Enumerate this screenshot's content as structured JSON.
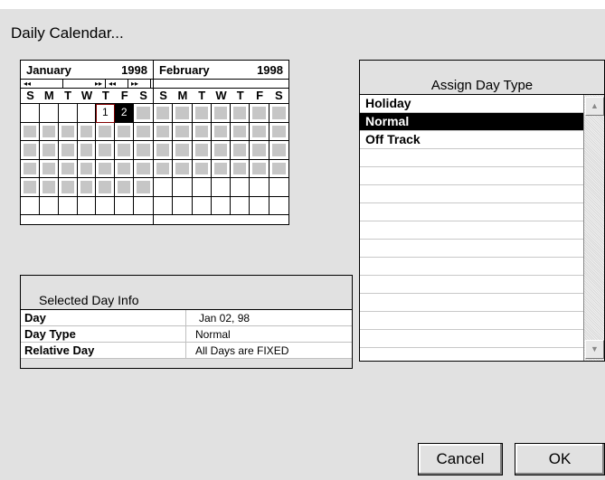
{
  "window": {
    "title": "Daily Calendar..."
  },
  "calendar": {
    "dow": [
      "S",
      "M",
      "T",
      "W",
      "T",
      "F",
      "S"
    ],
    "months": [
      {
        "name": "January",
        "year": "1998",
        "nav": [
          "◂◂",
          "▸▸",
          "◂◂",
          "▸▸"
        ]
      },
      {
        "name": "February",
        "year": "1998"
      }
    ],
    "jan_days": {
      "d1": "1",
      "d2": "2"
    }
  },
  "selected_day_info": {
    "header": "Selected Day Info",
    "rows": [
      {
        "label": "Day",
        "value": "Jan 02, 98"
      },
      {
        "label": "Day Type",
        "value": "Normal"
      },
      {
        "label": "Relative Day",
        "value": "All Days are FIXED"
      }
    ]
  },
  "assign_day_type": {
    "header": "Assign Day Type",
    "items": [
      "Holiday",
      "Normal",
      "Off Track"
    ],
    "selected": "Normal"
  },
  "buttons": {
    "cancel": "Cancel",
    "ok": "OK"
  },
  "icons": {
    "scroll_up": "scroll-up-arrow-icon",
    "scroll_down": "scroll-down-arrow-icon"
  }
}
